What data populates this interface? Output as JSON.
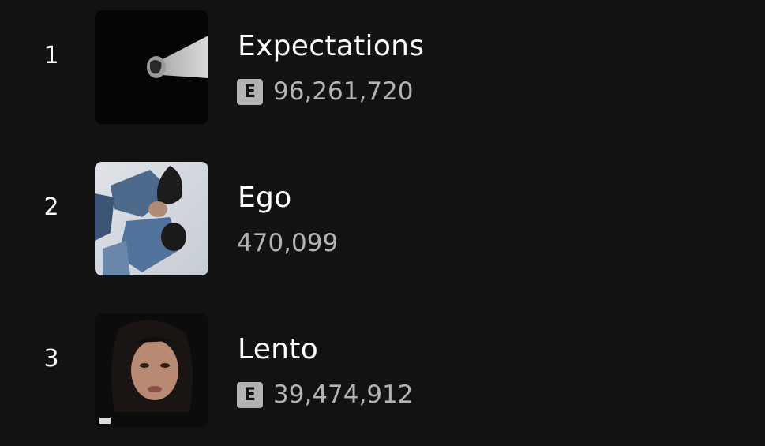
{
  "tracks": [
    {
      "rank": "1",
      "title": "Expectations",
      "explicit": true,
      "badge": "E",
      "plays": "96,261,720"
    },
    {
      "rank": "2",
      "title": "Ego",
      "explicit": false,
      "badge": "",
      "plays": "470,099"
    },
    {
      "rank": "3",
      "title": "Lento",
      "explicit": true,
      "badge": "E",
      "plays": "39,474,912"
    }
  ]
}
